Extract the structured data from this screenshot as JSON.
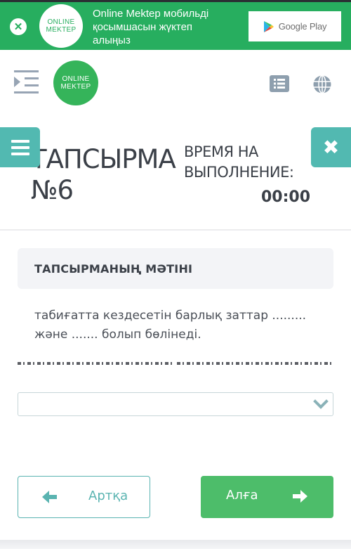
{
  "banner": {
    "close_icon": "close-circle-icon",
    "logo_line1": "ONLINE",
    "logo_line2": "MEKTEP",
    "text": "Online Mektep мобильді қосымшасын жүктеп алыңыз",
    "store_button_label": "Google Play",
    "store_icon": "google-play-icon"
  },
  "header": {
    "sidebar_toggle_icon": "indent-menu-icon",
    "logo_line1": "ONLINE",
    "logo_line2": "MEKTEP",
    "list_icon": "list-icon",
    "globe_icon": "globe-icon"
  },
  "floating": {
    "menu_icon": "hamburger-icon",
    "close_symbol": "✖"
  },
  "task": {
    "title": "ТАПСЫРМА №6",
    "time_label": "ВРЕМЯ НА ВЫПОЛНЕНИЕ:",
    "time_value": "00:00",
    "section_header": "ТАПСЫРМАНЫҢ МӘТІНІ",
    "question_text": "табиғатта кездесетін барлық заттар ......... және ....... болып бөлінеді.",
    "answer_select": {
      "selected_value": "",
      "icon": "chevron-down-icon"
    }
  },
  "navigation": {
    "back_label": "Артқа",
    "next_label": "Алға"
  },
  "colors": {
    "banner_green": "#27ae5f",
    "logo_green": "#35b45a",
    "teal": "#52b9b1",
    "next_green": "#4dbd6a",
    "icon_gray": "#8e9fae",
    "text_dark": "#3b4048"
  }
}
